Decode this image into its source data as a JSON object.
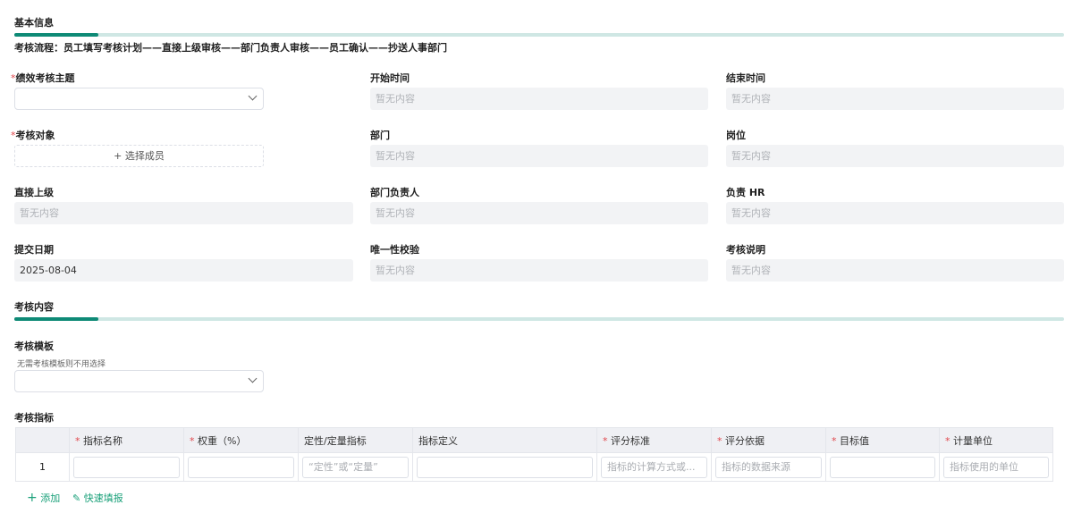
{
  "basic": {
    "title": "基本信息",
    "flow": "考核流程：员工填写考核计划——直接上级审核——部门负责人审核——员工确认——抄送人事部门"
  },
  "fields": [
    {
      "label": "绩效考核主题",
      "required": "*",
      "type": "select",
      "value": ""
    },
    {
      "label": "开始时间",
      "value": "暂无内容"
    },
    {
      "label": "结束时间",
      "value": "暂无内容"
    },
    {
      "label": "考核对象",
      "required": "*",
      "button": "+ 选择成员"
    },
    {
      "label": "部门",
      "value": "暂无内容"
    },
    {
      "label": "岗位",
      "value": "暂无内容"
    },
    {
      "label": "直接上级",
      "value": "暂无内容"
    },
    {
      "label": "部门负责人",
      "value": "暂无内容"
    },
    {
      "label": "负责 HR",
      "value": "暂无内容"
    },
    {
      "label": "提交日期",
      "value": "2025-08-04"
    },
    {
      "label": "唯一性校验",
      "value": "暂无内容"
    },
    {
      "label": "考核说明",
      "value": "暂无内容"
    }
  ],
  "content": {
    "title": "考核内容",
    "template_label": "考核模板",
    "template_hint": "无需考核模板则不用选择",
    "indicator_label": "考核指标"
  },
  "table": {
    "columns": [
      {
        "label": "",
        "req": ""
      },
      {
        "label": "指标名称",
        "req": "*"
      },
      {
        "label": "权重（%）",
        "req": "*"
      },
      {
        "label": "定性/定量指标",
        "req": ""
      },
      {
        "label": "指标定义",
        "req": ""
      },
      {
        "label": "评分标准",
        "req": "*"
      },
      {
        "label": "评分依据",
        "req": "*"
      },
      {
        "label": "目标值",
        "req": "*"
      },
      {
        "label": "计量单位",
        "req": "*"
      }
    ],
    "row_index": "1",
    "placeholders": [
      "",
      "",
      "“定性”或“定量”",
      "",
      "指标的计算方式或...",
      "指标的数据来源",
      "",
      "指标使用的单位"
    ]
  },
  "actions": {
    "add": "添加",
    "quick_fill": "快速填报"
  }
}
